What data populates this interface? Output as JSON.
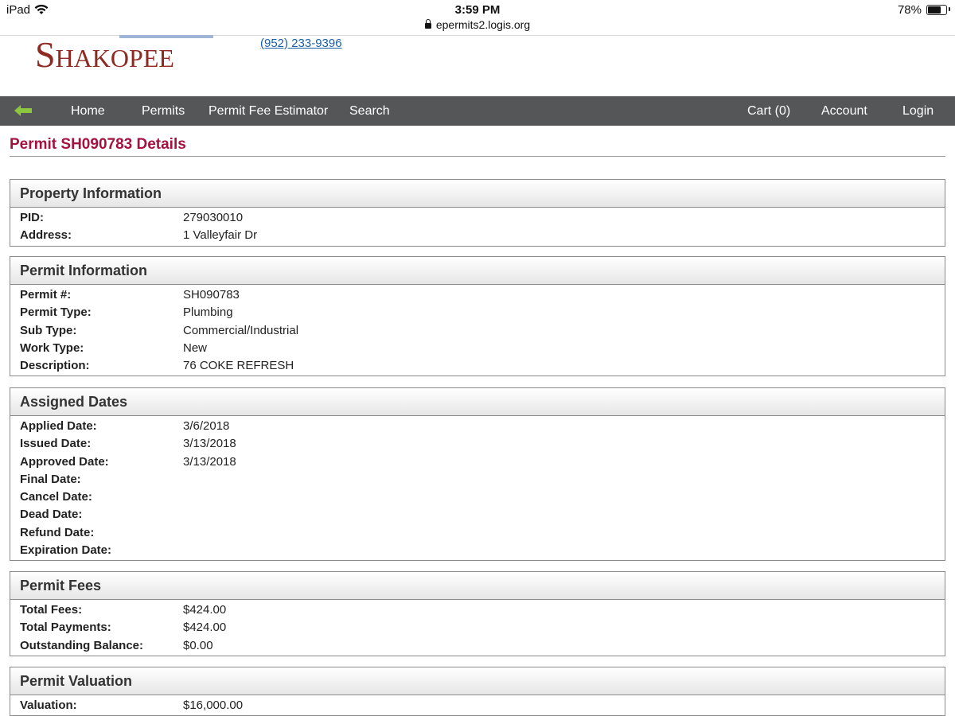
{
  "status_bar": {
    "device": "iPad",
    "time": "3:59 PM",
    "url": "epermits2.logis.org",
    "battery_percent": "78%",
    "battery_level": 0.78
  },
  "header": {
    "logo_text": "Shakopee",
    "phone": "(952) 233-9396"
  },
  "nav": {
    "back_icon": "back-arrow-icon",
    "items": [
      "Home",
      "Permits",
      "Permit Fee Estimator",
      "Search"
    ],
    "right_items": [
      "Cart (0)",
      "Account",
      "Login"
    ]
  },
  "page": {
    "title": "Permit SH090783 Details"
  },
  "sections": {
    "property": {
      "heading": "Property Information",
      "rows": [
        {
          "label": "PID:",
          "value": "279030010"
        },
        {
          "label": "Address:",
          "value": "1 Valleyfair Dr"
        }
      ]
    },
    "permit": {
      "heading": "Permit Information",
      "rows": [
        {
          "label": "Permit #:",
          "value": "SH090783"
        },
        {
          "label": "Permit Type:",
          "value": "Plumbing"
        },
        {
          "label": "Sub Type:",
          "value": "Commercial/Industrial"
        },
        {
          "label": "Work Type:",
          "value": "New"
        },
        {
          "label": "Description:",
          "value": "76 COKE REFRESH"
        }
      ]
    },
    "dates": {
      "heading": "Assigned Dates",
      "rows": [
        {
          "label": "Applied Date:",
          "value": "3/6/2018"
        },
        {
          "label": "Issued Date:",
          "value": "3/13/2018"
        },
        {
          "label": "Approved Date:",
          "value": "3/13/2018"
        },
        {
          "label": "Final Date:",
          "value": ""
        },
        {
          "label": "Cancel Date:",
          "value": ""
        },
        {
          "label": "Dead Date:",
          "value": ""
        },
        {
          "label": "Refund Date:",
          "value": ""
        },
        {
          "label": "Expiration Date:",
          "value": ""
        }
      ]
    },
    "fees": {
      "heading": "Permit Fees",
      "rows": [
        {
          "label": "Total Fees:",
          "value": "$424.00"
        },
        {
          "label": "Total Payments:",
          "value": "$424.00"
        },
        {
          "label": "Outstanding Balance:",
          "value": "$0.00"
        }
      ]
    },
    "valuation": {
      "heading": "Permit Valuation",
      "rows": [
        {
          "label": "Valuation:",
          "value": "$16,000.00"
        }
      ]
    }
  },
  "colors": {
    "nav_bg": "#555657",
    "title": "#a3123f",
    "logo": "#8f2a22",
    "link": "#1a5fa8",
    "back_arrow": "#8cc63e"
  }
}
